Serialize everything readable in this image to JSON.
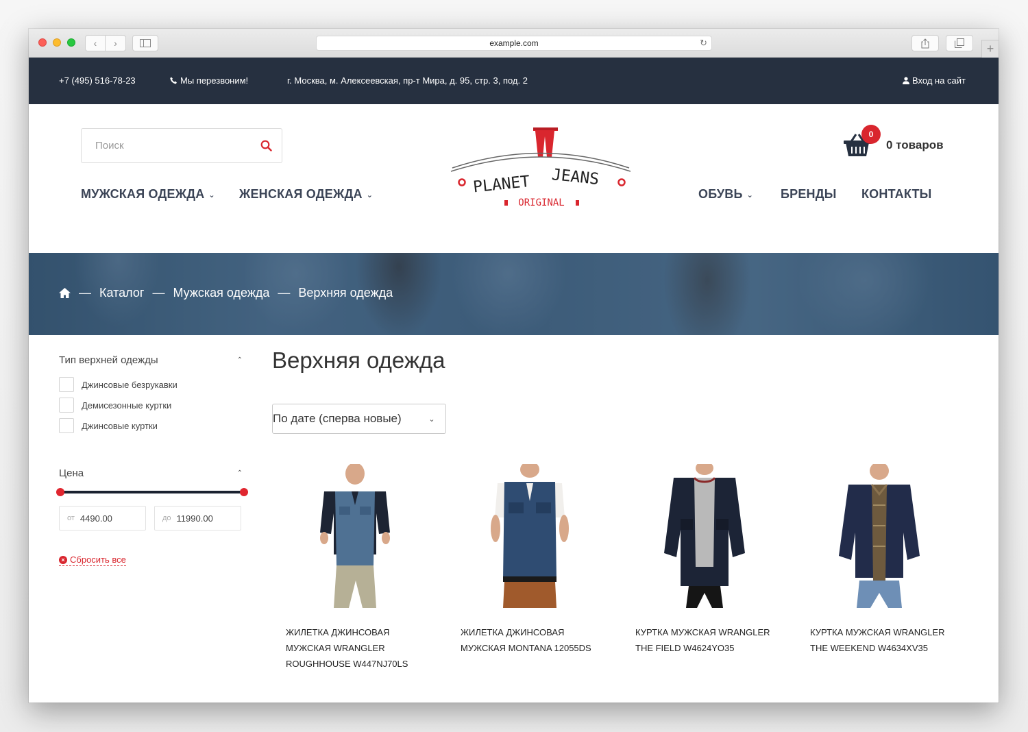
{
  "browser": {
    "url": "example.com"
  },
  "topbar": {
    "phone": "+7 (495) 516-78-23",
    "callback": "Мы перезвоним!",
    "address": "г. Москва, м. Алексеевская, пр-т Мира, д. 95, стр. 3, под. 2",
    "login": "Вход на сайт"
  },
  "header": {
    "search_placeholder": "Поиск",
    "nav_left": [
      "МУЖСКАЯ ОДЕЖДА",
      "ЖЕНСКАЯ ОДЕЖДА"
    ],
    "nav_right": [
      "ОБУВЬ",
      "БРЕНДЫ",
      "КОНТАКТЫ"
    ],
    "logo": {
      "line1": "PLANET",
      "line2": "JEANS",
      "sub": "ORIGINAL"
    },
    "cart": {
      "count": "0",
      "label": "0 товаров"
    }
  },
  "breadcrumbs": [
    "Каталог",
    "Мужская одежда",
    "Верхняя одежда"
  ],
  "filters": {
    "type_title": "Тип верхней одежды",
    "types": [
      "Джинсовые безрукавки",
      "Демисезонные куртки",
      "Джинсовые куртки"
    ],
    "price_title": "Цена",
    "price_from_prefix": "от",
    "price_from": "4490.00",
    "price_to_prefix": "до",
    "price_to": "11990.00",
    "reset_label": "Сбросить все"
  },
  "main": {
    "title": "Верхняя одежда",
    "sort_value": "По дате (сперва новые)"
  },
  "products": [
    {
      "name": "ЖИЛЕТКА ДЖИНСОВАЯ МУЖСКАЯ WRANGLER ROUGHHOUSE W447NJ70LS"
    },
    {
      "name": "ЖИЛЕТКА ДЖИНСОВАЯ МУЖСКАЯ MONTANA 12055DS"
    },
    {
      "name": "КУРТКА МУЖСКАЯ WRANGLER THE FIELD W4624YO35"
    },
    {
      "name": "КУРТКА МУЖСКАЯ WRANGLER THE WEEKEND W4634XV35"
    }
  ],
  "colors": {
    "accent": "#d9262e",
    "topbar": "#263040",
    "nav_text": "#3b4456"
  }
}
